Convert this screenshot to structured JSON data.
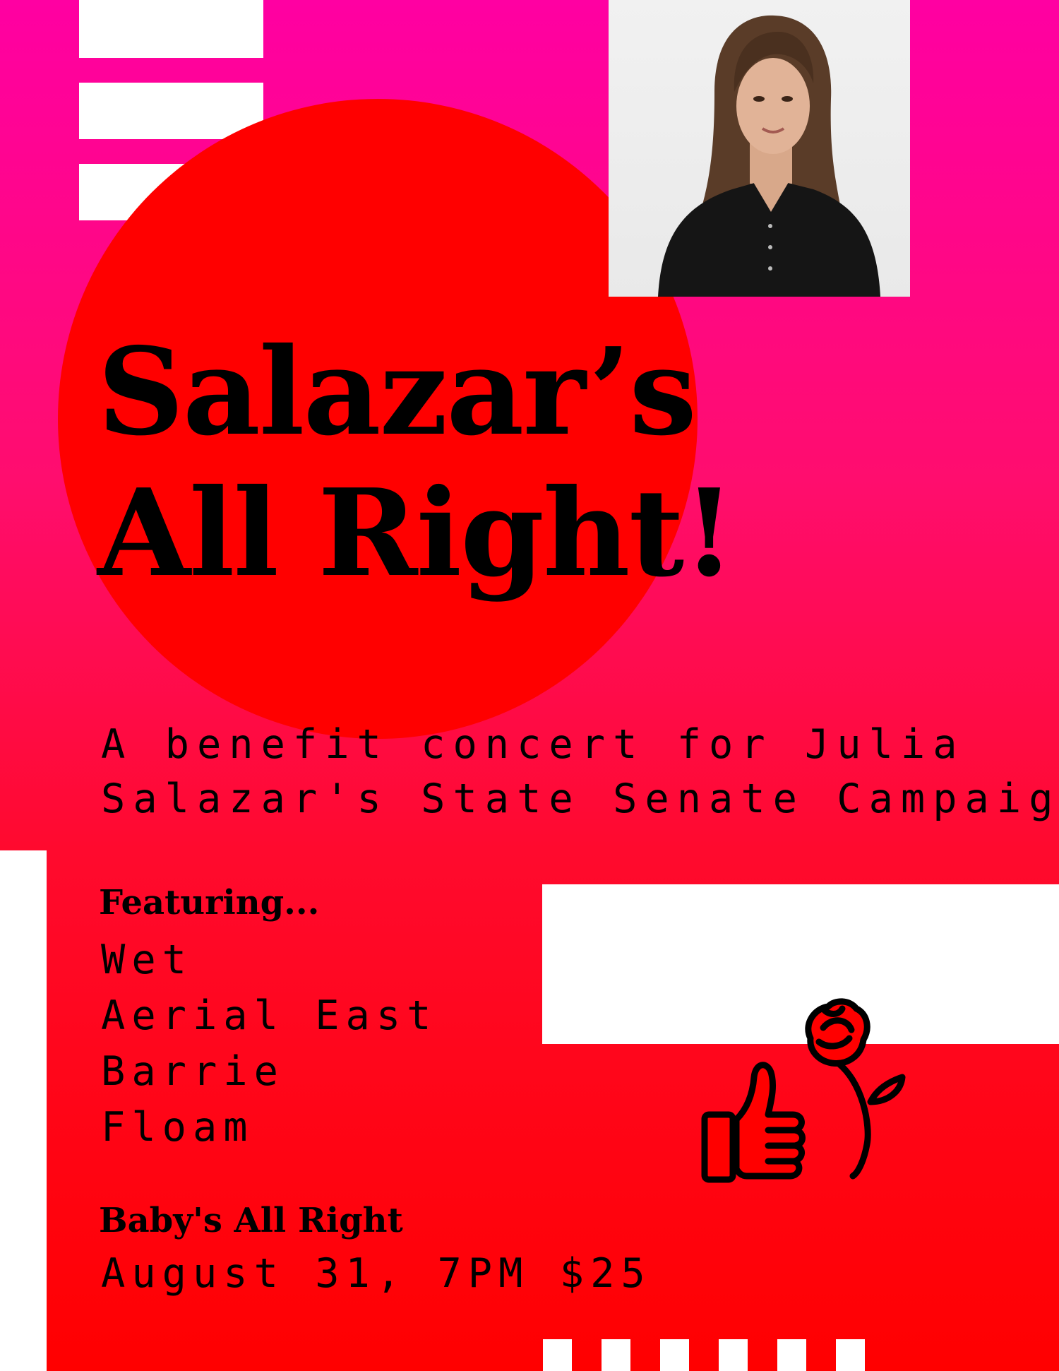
{
  "poster": {
    "title_line1": "Salazar’s",
    "title_line2": "All Right!",
    "subtitle_line1": "A benefit concert for Julia",
    "subtitle_line2": "Salazar's State Senate Campaign",
    "featuring_heading": "Featuring...",
    "lineup": [
      "Wet",
      "Aerial East",
      "Barrie",
      "Floam"
    ],
    "venue": "Baby's All Right",
    "event_info": "August 31, 7PM $25"
  },
  "icons": {
    "portrait": "portrait-photo",
    "logo": "thumbs-up-rose-icon"
  },
  "colors": {
    "background_top": "#ff00a2",
    "background_bottom": "#ff0000",
    "circle": "#ff0000",
    "text": "#000000",
    "accent": "#ffffff"
  }
}
